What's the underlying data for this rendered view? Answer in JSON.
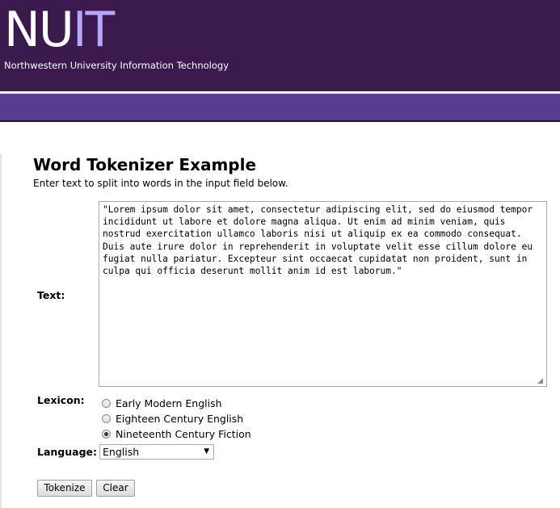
{
  "header": {
    "logo_nu": "NU",
    "logo_it": "IT",
    "subtitle": "Northwestern University Information Technology"
  },
  "main": {
    "title": "Word Tokenizer Example",
    "intro": "Enter text to split into words in the input field below.",
    "text_label": "Text:",
    "text_value": "\"Lorem ipsum dolor sit amet, consectetur adipiscing elit, sed do eiusmod tempor incididunt ut labore et dolore magna aliqua. Ut enim ad minim veniam, quis nostrud exercitation ullamco laboris nisi ut aliquip ex ea commodo consequat. Duis aute irure dolor in reprehenderit in voluptate velit esse cillum dolore eu fugiat nulla pariatur. Excepteur sint occaecat cupidatat non proident, sunt in culpa qui officia deserunt mollit anim id est laborum.\"",
    "lexicon_label": "Lexicon:",
    "lexicon_options": [
      {
        "label": "Early Modern English",
        "checked": false
      },
      {
        "label": "Eighteen Century English",
        "checked": false
      },
      {
        "label": "Nineteenth Century Fiction",
        "checked": true
      }
    ],
    "language_label": "Language:",
    "language_selected": "English",
    "tokenize_label": "Tokenize",
    "clear_label": "Clear"
  },
  "colors": {
    "header_bg": "#3b1a4e",
    "nav_bg": "#563d91",
    "logo_it": "#b7a8ff"
  },
  "icons": {
    "select_arrow": "chevron-down-icon",
    "radio": "radio-icon"
  }
}
